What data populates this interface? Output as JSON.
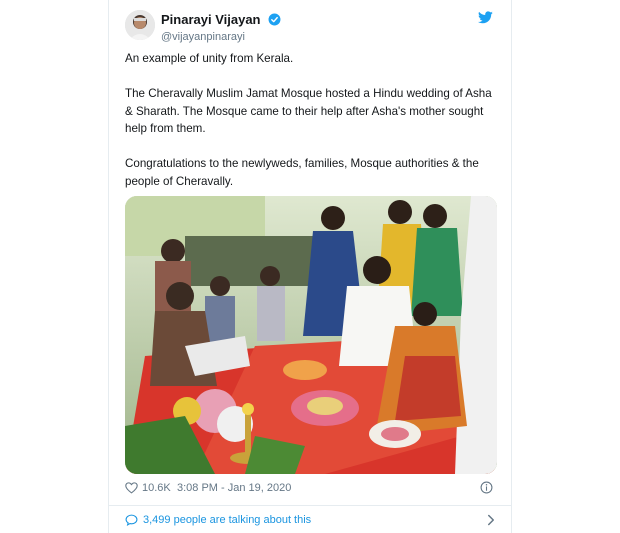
{
  "tweet": {
    "author": {
      "display_name": "Pinarayi Vijayan",
      "handle": "@vijayanpinarayi",
      "verified": true
    },
    "paragraphs": [
      "An example of unity from Kerala.",
      "The Cheravally Muslim Jamat Mosque hosted a Hindu wedding of Asha & Sharath. The Mosque came to their help after Asha's mother sought help from them.",
      "Congratulations to the newlyweds, families, Mosque authorities & the people of Cheravally."
    ],
    "likes": "10.6K",
    "timestamp": "3:08 PM - Jan 19, 2020",
    "talking_about": "3,499 people are talking about this"
  },
  "icons": {
    "brand": "twitter-bird-icon",
    "verified": "verified-badge-icon",
    "like": "heart-icon",
    "info": "info-icon",
    "conversation": "speech-bubble-icon",
    "chevron": "chevron-right-icon"
  },
  "colors": {
    "brand_blue": "#1da1f2",
    "link_blue": "#1b95e0",
    "secondary_text": "#657786",
    "primary_text": "#14171a"
  }
}
